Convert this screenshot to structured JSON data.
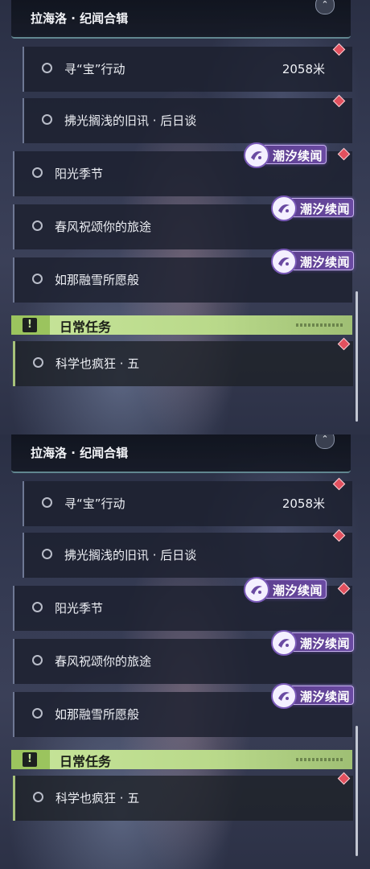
{
  "header": {
    "title": "拉海洛 · 纪闻合辑",
    "collapse_glyph": "⌃"
  },
  "quests": {
    "q1": {
      "label": "寻“宝”行动",
      "distance": "2058米"
    },
    "q2": {
      "label": "拂光搁浅的旧讯 · 后日谈"
    },
    "q3": {
      "label": "阳光季节"
    },
    "q4": {
      "label": "春风祝颂你的旅途"
    },
    "q5": {
      "label": "如那融雪所愿般"
    }
  },
  "badge": {
    "text": "潮汐续闻"
  },
  "section": {
    "icon_glyph": "!",
    "title": "日常任务"
  },
  "daily": {
    "q1": {
      "label": "科学也疯狂 · 五"
    }
  },
  "colors": {
    "accent_green": "#c7e59a",
    "badge_purple": "#6a4aa2",
    "marker_red": "#e2505e"
  }
}
